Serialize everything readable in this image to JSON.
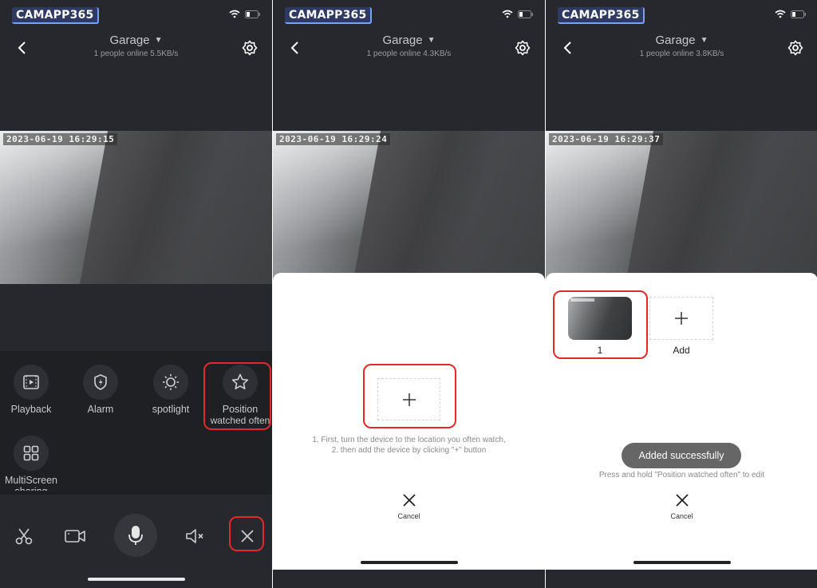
{
  "watermark": "CAMAPP365",
  "panels": [
    {
      "title": "Garage",
      "subtitle": "1 people online   5.5KB/s",
      "timestamp": "2023-06-19   16:29:15"
    },
    {
      "title": "Garage",
      "subtitle": "1 people online   4.3KB/s",
      "timestamp": "2023-06-19   16:29:24"
    },
    {
      "title": "Garage",
      "subtitle": "1 people online   3.8KB/s",
      "timestamp": "2023-06-19   16:29:37"
    }
  ],
  "controls": {
    "playback": "Playback",
    "alarm": "Alarm",
    "spotlight": "spotlight",
    "position_line1": "Position",
    "position_line2": "watched often",
    "multiscreen_line1": "MultiScreen",
    "multiscreen_line2": "sharing"
  },
  "add_sheet": {
    "hint_line1": "1. First, turn the device to the location you often watch,",
    "hint_line2": "2. then add the device by clicking \"+\" button",
    "cancel": "Cancel"
  },
  "result_sheet": {
    "saved_label": "1",
    "add_label": "Add",
    "toast": "Added successfully",
    "hint": "Press and hold \"Position watched often\" to edit",
    "cancel": "Cancel"
  },
  "icons": [
    "back-icon",
    "gear-icon",
    "caret-down-icon",
    "wifi-icon",
    "battery-icon",
    "playback-icon",
    "alarm-icon",
    "spotlight-icon",
    "star-icon",
    "multiscreen-icon",
    "scissors-icon",
    "video-camera-icon",
    "microphone-icon",
    "speaker-mute-icon",
    "close-icon",
    "plus-icon"
  ],
  "colors": {
    "highlight": "#e12a2a",
    "background": "#27282e",
    "sheet": "#ffffff"
  }
}
